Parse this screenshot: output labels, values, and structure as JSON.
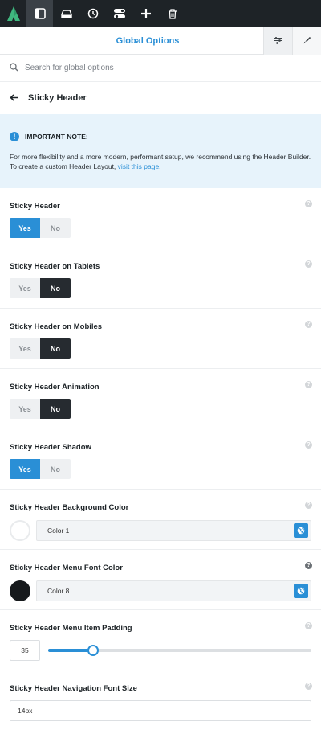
{
  "toolbar": {
    "logo_icon": "astra-logo-icon",
    "items": [
      "layout-icon",
      "drive-icon",
      "history-icon",
      "toggles-icon",
      "add-icon",
      "trash-icon"
    ],
    "active_index": 0
  },
  "header": {
    "title": "Global Options",
    "buttons": [
      "sliders-icon",
      "brush-icon"
    ]
  },
  "search": {
    "placeholder": "Search for global options",
    "value": ""
  },
  "section": {
    "back_icon": "arrow-left-icon",
    "title": "Sticky Header"
  },
  "note": {
    "title": "IMPORTANT NOTE:",
    "body": "For more flexibility and a more modern, performant setup, we recommend using the Header Builder. To create a custom Header Layout,",
    "link": "visit this page",
    "suffix": "."
  },
  "settings": [
    {
      "label": "Sticky Header",
      "type": "toggle",
      "yes": "Yes",
      "no": "No",
      "value": "Yes"
    },
    {
      "label": "Sticky Header on Tablets",
      "type": "toggle",
      "yes": "Yes",
      "no": "No",
      "value": "No"
    },
    {
      "label": "Sticky Header on Mobiles",
      "type": "toggle",
      "yes": "Yes",
      "no": "No",
      "value": "No"
    },
    {
      "label": "Sticky Header Animation",
      "type": "toggle",
      "yes": "Yes",
      "no": "No",
      "value": "No"
    },
    {
      "label": "Sticky Header Shadow",
      "type": "toggle",
      "yes": "Yes",
      "no": "No",
      "value": "Yes"
    },
    {
      "label": "Sticky Header Background Color",
      "type": "color",
      "value": "Color 1",
      "swatch": "#ffffff"
    },
    {
      "label": "Sticky Header Menu Font Color",
      "type": "color",
      "value": "Color 8",
      "swatch": "#16191c"
    },
    {
      "label": "Sticky Header Menu Item Padding",
      "type": "range",
      "value": "35",
      "fraction": 0.17
    },
    {
      "label": "Sticky Header Navigation Font Size",
      "type": "text",
      "value": "14px"
    }
  ],
  "colors": {
    "accent": "#2a8fd6",
    "dark": "#262b30",
    "topbar": "#1e2327"
  }
}
